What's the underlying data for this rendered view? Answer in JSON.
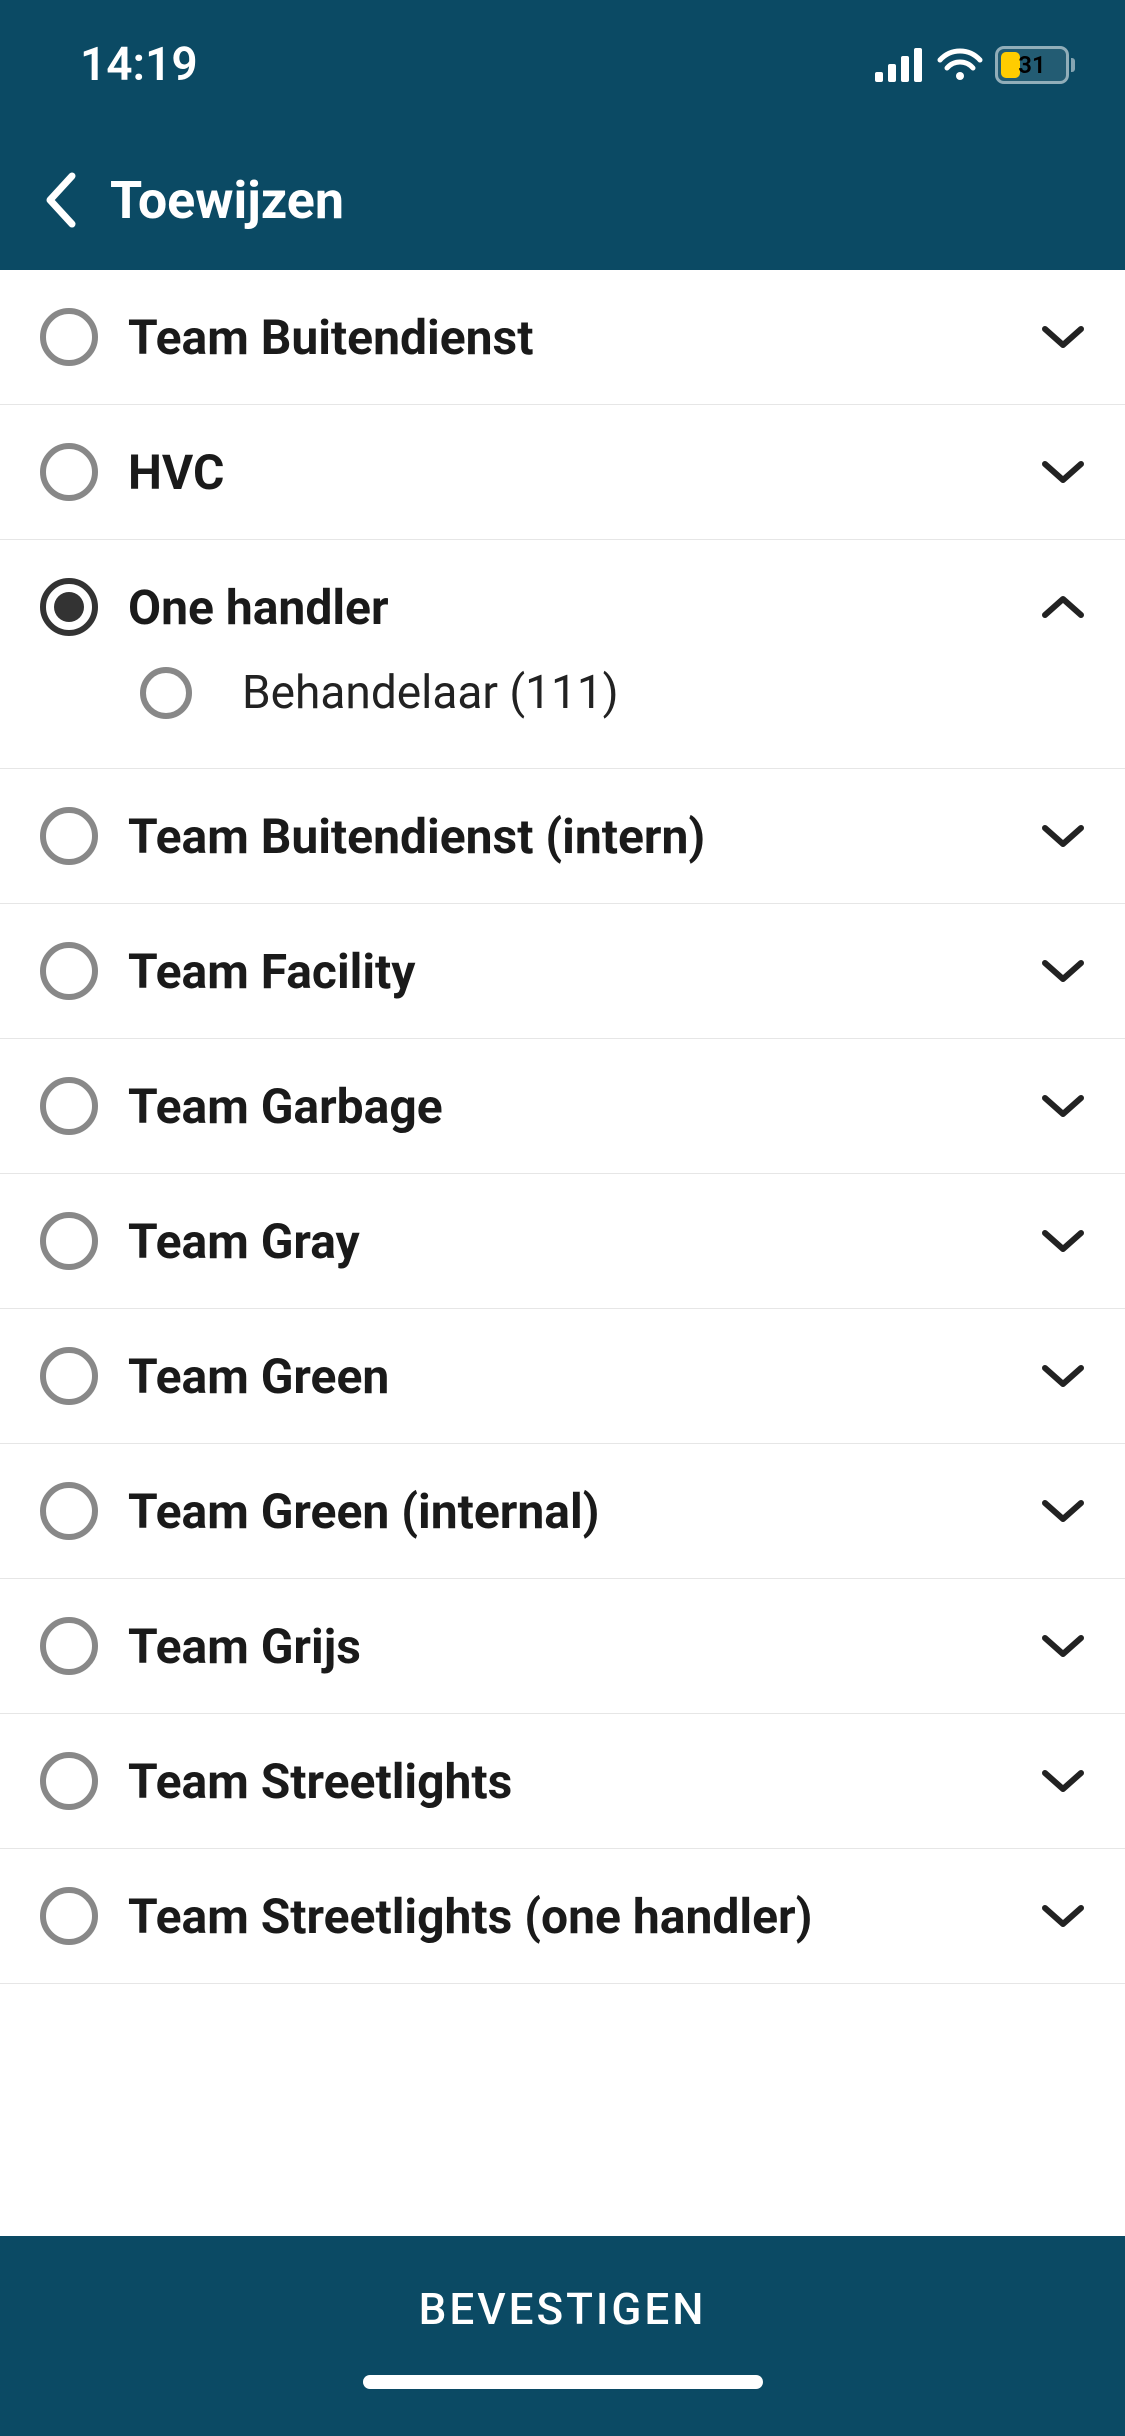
{
  "status": {
    "time": "14:19",
    "battery_pct": "31"
  },
  "nav": {
    "title": "Toewijzen"
  },
  "teams": [
    {
      "label": "Team Buitendienst",
      "selected": false,
      "expanded": false
    },
    {
      "label": "HVC",
      "selected": false,
      "expanded": false
    },
    {
      "label": "One handler",
      "selected": true,
      "expanded": true,
      "children": [
        {
          "label": "Behandelaar (111)",
          "selected": false
        }
      ]
    },
    {
      "label": "Team Buitendienst (intern)",
      "selected": false,
      "expanded": false
    },
    {
      "label": "Team Facility",
      "selected": false,
      "expanded": false
    },
    {
      "label": "Team Garbage",
      "selected": false,
      "expanded": false
    },
    {
      "label": "Team Gray",
      "selected": false,
      "expanded": false
    },
    {
      "label": "Team Green",
      "selected": false,
      "expanded": false
    },
    {
      "label": "Team Green (internal)",
      "selected": false,
      "expanded": false
    },
    {
      "label": "Team Grijs",
      "selected": false,
      "expanded": false
    },
    {
      "label": "Team Streetlights",
      "selected": false,
      "expanded": false
    },
    {
      "label": "Team Streetlights (one handler)",
      "selected": false,
      "expanded": false
    }
  ],
  "footer": {
    "confirm": "BEVESTIGEN"
  }
}
